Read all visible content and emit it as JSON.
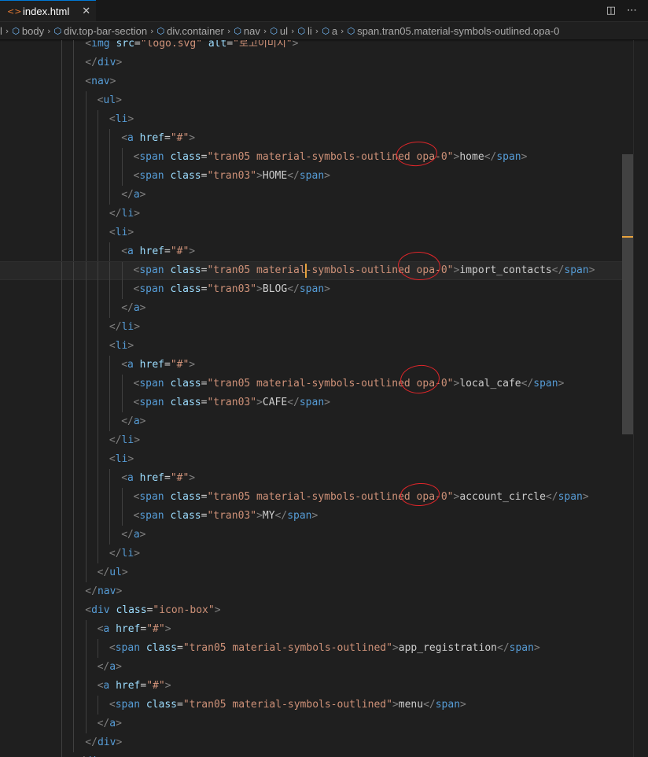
{
  "tab": {
    "icon": "<>",
    "label": "index.html",
    "close": "✕"
  },
  "editor_actions": {
    "split": "◫",
    "more": "⋯"
  },
  "breadcrumbs": [
    {
      "label": "l",
      "symbol": ""
    },
    {
      "label": "body",
      "symbol": "⬡"
    },
    {
      "label": "div.top-bar-section",
      "symbol": "⬡"
    },
    {
      "label": "div.container",
      "symbol": "⬡"
    },
    {
      "label": "nav",
      "symbol": "⬡"
    },
    {
      "label": "ul",
      "symbol": "⬡"
    },
    {
      "label": "li",
      "symbol": "⬡"
    },
    {
      "label": "a",
      "symbol": "⬡"
    },
    {
      "label": "span.tran05.material-symbols-outlined.opa-0",
      "symbol": "⬡"
    }
  ],
  "code_lines": [
    [
      [
        "br",
        "<"
      ],
      [
        "tag",
        "img "
      ],
      [
        "attr",
        "src"
      ],
      [
        "eq",
        "="
      ],
      [
        "str",
        "\"logo.svg\""
      ],
      [
        "attr",
        " alt"
      ],
      [
        "eq",
        "="
      ],
      [
        "str",
        "\"로고이미지\""
      ],
      [
        "br",
        ">"
      ]
    ],
    [
      [
        "br",
        "</"
      ],
      [
        "tag",
        "div"
      ],
      [
        "br",
        ">"
      ]
    ],
    [
      [
        "br",
        "<"
      ],
      [
        "tag",
        "nav"
      ],
      [
        "br",
        ">"
      ]
    ],
    [
      [
        "br",
        "<"
      ],
      [
        "tag",
        "ul"
      ],
      [
        "br",
        ">"
      ]
    ],
    [
      [
        "br",
        "<"
      ],
      [
        "tag",
        "li"
      ],
      [
        "br",
        ">"
      ]
    ],
    [
      [
        "br",
        "<"
      ],
      [
        "tag",
        "a "
      ],
      [
        "attr",
        "href"
      ],
      [
        "eq",
        "="
      ],
      [
        "str",
        "\"#\""
      ],
      [
        "br",
        ">"
      ]
    ],
    [
      [
        "br",
        "<"
      ],
      [
        "tag",
        "span "
      ],
      [
        "attr",
        "class"
      ],
      [
        "eq",
        "="
      ],
      [
        "str",
        "\"tran05 material-symbols-outlined opa-0\""
      ],
      [
        "br",
        ">"
      ],
      [
        "txt",
        "home"
      ],
      [
        "br",
        "</"
      ],
      [
        "tag",
        "span"
      ],
      [
        "br",
        ">"
      ]
    ],
    [
      [
        "br",
        "<"
      ],
      [
        "tag",
        "span "
      ],
      [
        "attr",
        "class"
      ],
      [
        "eq",
        "="
      ],
      [
        "str",
        "\"tran03\""
      ],
      [
        "br",
        ">"
      ],
      [
        "txt",
        "HOME"
      ],
      [
        "br",
        "</"
      ],
      [
        "tag",
        "span"
      ],
      [
        "br",
        ">"
      ]
    ],
    [
      [
        "br",
        "</"
      ],
      [
        "tag",
        "a"
      ],
      [
        "br",
        ">"
      ]
    ],
    [
      [
        "br",
        "</"
      ],
      [
        "tag",
        "li"
      ],
      [
        "br",
        ">"
      ]
    ],
    [
      [
        "br",
        "<"
      ],
      [
        "tag",
        "li"
      ],
      [
        "br",
        ">"
      ]
    ],
    [
      [
        "br",
        "<"
      ],
      [
        "tag",
        "a "
      ],
      [
        "attr",
        "href"
      ],
      [
        "eq",
        "="
      ],
      [
        "str",
        "\"#\""
      ],
      [
        "br",
        ">"
      ]
    ],
    [
      [
        "br",
        "<"
      ],
      [
        "tag",
        "span "
      ],
      [
        "attr",
        "class"
      ],
      [
        "eq",
        "="
      ],
      [
        "str",
        "\"tran05 material"
      ],
      [
        "cursor",
        ""
      ],
      [
        "str",
        "-symbols-outlined opa-0\""
      ],
      [
        "br",
        ">"
      ],
      [
        "txt",
        "import_contacts"
      ],
      [
        "br",
        "</"
      ],
      [
        "tag",
        "span"
      ],
      [
        "br",
        ">"
      ]
    ],
    [
      [
        "br",
        "<"
      ],
      [
        "tag",
        "span "
      ],
      [
        "attr",
        "class"
      ],
      [
        "eq",
        "="
      ],
      [
        "str",
        "\"tran03\""
      ],
      [
        "br",
        ">"
      ],
      [
        "txt",
        "BLOG"
      ],
      [
        "br",
        "</"
      ],
      [
        "tag",
        "span"
      ],
      [
        "br",
        ">"
      ]
    ],
    [
      [
        "br",
        "</"
      ],
      [
        "tag",
        "a"
      ],
      [
        "br",
        ">"
      ]
    ],
    [
      [
        "br",
        "</"
      ],
      [
        "tag",
        "li"
      ],
      [
        "br",
        ">"
      ]
    ],
    [
      [
        "br",
        "<"
      ],
      [
        "tag",
        "li"
      ],
      [
        "br",
        ">"
      ]
    ],
    [
      [
        "br",
        "<"
      ],
      [
        "tag",
        "a "
      ],
      [
        "attr",
        "href"
      ],
      [
        "eq",
        "="
      ],
      [
        "str",
        "\"#\""
      ],
      [
        "br",
        ">"
      ]
    ],
    [
      [
        "br",
        "<"
      ],
      [
        "tag",
        "span "
      ],
      [
        "attr",
        "class"
      ],
      [
        "eq",
        "="
      ],
      [
        "str",
        "\"tran05 material-symbols-outlined opa-0\""
      ],
      [
        "br",
        ">"
      ],
      [
        "txt",
        "local_cafe"
      ],
      [
        "br",
        "</"
      ],
      [
        "tag",
        "span"
      ],
      [
        "br",
        ">"
      ]
    ],
    [
      [
        "br",
        "<"
      ],
      [
        "tag",
        "span "
      ],
      [
        "attr",
        "class"
      ],
      [
        "eq",
        "="
      ],
      [
        "str",
        "\"tran03\""
      ],
      [
        "br",
        ">"
      ],
      [
        "txt",
        "CAFE"
      ],
      [
        "br",
        "</"
      ],
      [
        "tag",
        "span"
      ],
      [
        "br",
        ">"
      ]
    ],
    [
      [
        "br",
        "</"
      ],
      [
        "tag",
        "a"
      ],
      [
        "br",
        ">"
      ]
    ],
    [
      [
        "br",
        "</"
      ],
      [
        "tag",
        "li"
      ],
      [
        "br",
        ">"
      ]
    ],
    [
      [
        "br",
        "<"
      ],
      [
        "tag",
        "li"
      ],
      [
        "br",
        ">"
      ]
    ],
    [
      [
        "br",
        "<"
      ],
      [
        "tag",
        "a "
      ],
      [
        "attr",
        "href"
      ],
      [
        "eq",
        "="
      ],
      [
        "str",
        "\"#\""
      ],
      [
        "br",
        ">"
      ]
    ],
    [
      [
        "br",
        "<"
      ],
      [
        "tag",
        "span "
      ],
      [
        "attr",
        "class"
      ],
      [
        "eq",
        "="
      ],
      [
        "str",
        "\"tran05 material-symbols-outlined opa-0\""
      ],
      [
        "br",
        ">"
      ],
      [
        "txt",
        "account_circle"
      ],
      [
        "br",
        "</"
      ],
      [
        "tag",
        "span"
      ],
      [
        "br",
        ">"
      ]
    ],
    [
      [
        "br",
        "<"
      ],
      [
        "tag",
        "span "
      ],
      [
        "attr",
        "class"
      ],
      [
        "eq",
        "="
      ],
      [
        "str",
        "\"tran03\""
      ],
      [
        "br",
        ">"
      ],
      [
        "txt",
        "MY"
      ],
      [
        "br",
        "</"
      ],
      [
        "tag",
        "span"
      ],
      [
        "br",
        ">"
      ]
    ],
    [
      [
        "br",
        "</"
      ],
      [
        "tag",
        "a"
      ],
      [
        "br",
        ">"
      ]
    ],
    [
      [
        "br",
        "</"
      ],
      [
        "tag",
        "li"
      ],
      [
        "br",
        ">"
      ]
    ],
    [
      [
        "br",
        "</"
      ],
      [
        "tag",
        "ul"
      ],
      [
        "br",
        ">"
      ]
    ],
    [
      [
        "br",
        "</"
      ],
      [
        "tag",
        "nav"
      ],
      [
        "br",
        ">"
      ]
    ],
    [
      [
        "br",
        "<"
      ],
      [
        "tag",
        "div "
      ],
      [
        "attr",
        "class"
      ],
      [
        "eq",
        "="
      ],
      [
        "str",
        "\"icon-box\""
      ],
      [
        "br",
        ">"
      ]
    ],
    [
      [
        "br",
        "<"
      ],
      [
        "tag",
        "a "
      ],
      [
        "attr",
        "href"
      ],
      [
        "eq",
        "="
      ],
      [
        "str",
        "\"#\""
      ],
      [
        "br",
        ">"
      ]
    ],
    [
      [
        "br",
        "<"
      ],
      [
        "tag",
        "span "
      ],
      [
        "attr",
        "class"
      ],
      [
        "eq",
        "="
      ],
      [
        "str",
        "\"tran05 material-symbols-outlined\""
      ],
      [
        "br",
        ">"
      ],
      [
        "txt",
        "app_registration"
      ],
      [
        "br",
        "</"
      ],
      [
        "tag",
        "span"
      ],
      [
        "br",
        ">"
      ]
    ],
    [
      [
        "br",
        "</"
      ],
      [
        "tag",
        "a"
      ],
      [
        "br",
        ">"
      ]
    ],
    [
      [
        "br",
        "<"
      ],
      [
        "tag",
        "a "
      ],
      [
        "attr",
        "href"
      ],
      [
        "eq",
        "="
      ],
      [
        "str",
        "\"#\""
      ],
      [
        "br",
        ">"
      ]
    ],
    [
      [
        "br",
        "<"
      ],
      [
        "tag",
        "span "
      ],
      [
        "attr",
        "class"
      ],
      [
        "eq",
        "="
      ],
      [
        "str",
        "\"tran05 material-symbols-outlined\""
      ],
      [
        "br",
        ">"
      ],
      [
        "txt",
        "menu"
      ],
      [
        "br",
        "</"
      ],
      [
        "tag",
        "span"
      ],
      [
        "br",
        ">"
      ]
    ],
    [
      [
        "br",
        "</"
      ],
      [
        "tag",
        "a"
      ],
      [
        "br",
        ">"
      ]
    ],
    [
      [
        "br",
        "</"
      ],
      [
        "tag",
        "div"
      ],
      [
        "br",
        ">"
      ]
    ],
    [
      [
        "br",
        "</"
      ],
      [
        "tag",
        "div"
      ],
      [
        "br",
        ">"
      ]
    ]
  ],
  "current_line_index": 12
}
